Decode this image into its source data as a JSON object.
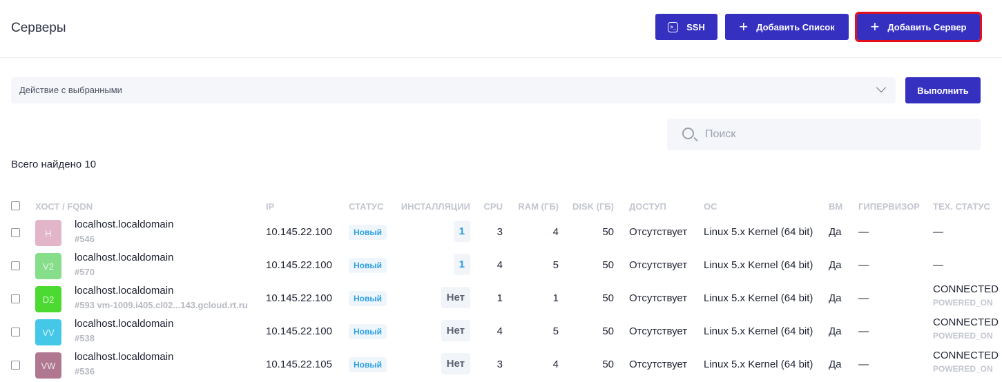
{
  "header": {
    "title": "Серверы",
    "ssh_label": "SSH",
    "add_list_label": "Добавить Список",
    "add_server_label": "Добавить Сервер"
  },
  "actions": {
    "select_placeholder": "Действие с выбранными",
    "run_label": "Выполнить"
  },
  "search": {
    "placeholder": "Поиск"
  },
  "total": "Всего найдено 10",
  "columns": {
    "host": "ХОСТ / FQDN",
    "ip": "IP",
    "status": "СТАТУС",
    "installs": "ИНСТАЛЛЯЦИИ",
    "cpu": "CPU",
    "ram": "RAM (ГБ)",
    "disk": "DISK (ГБ)",
    "access": "ДОСТУП",
    "os": "ОС",
    "vm": "ВМ",
    "hypervisor": "ГИПЕРВИЗОР",
    "tech_status": "ТЕХ. СТАТУС"
  },
  "rows": [
    {
      "avatar": "H",
      "avatar_color": "#e2b5c8",
      "name": "localhost.localdomain",
      "sub": "#546",
      "ip": "10.145.22.100",
      "status": "Новый",
      "installs": "1",
      "cpu": "3",
      "ram": "4",
      "disk": "50",
      "access": "Отсутствует",
      "os": "Linux 5.x Kernel (64 bit)",
      "vm": "Да",
      "hypervisor": "—",
      "tech": "—",
      "tech_sub": ""
    },
    {
      "avatar": "V2",
      "avatar_color": "#86dd8a",
      "name": "localhost.localdomain",
      "sub": "#570",
      "ip": "10.145.22.100",
      "status": "Новый",
      "installs": "1",
      "cpu": "4",
      "ram": "5",
      "disk": "50",
      "access": "Отсутствует",
      "os": "Linux 5.x Kernel (64 bit)",
      "vm": "Да",
      "hypervisor": "—",
      "tech": "—",
      "tech_sub": ""
    },
    {
      "avatar": "D2",
      "avatar_color": "#4cd932",
      "name": "localhost.localdomain",
      "sub": "#593 vm-1009.i405.cl02...143.gcloud.rt.ru",
      "ip": "10.145.22.100",
      "status": "Новый",
      "installs": "Нет",
      "cpu": "1",
      "ram": "1",
      "disk": "50",
      "access": "Отсутствует",
      "os": "Linux 5.x Kernel (64 bit)",
      "vm": "Да",
      "hypervisor": "—",
      "tech": "CONNECTED",
      "tech_sub": "POWERED_ON"
    },
    {
      "avatar": "VV",
      "avatar_color": "#45c8e8",
      "name": "localhost.localdomain",
      "sub": "#538",
      "ip": "10.145.22.100",
      "status": "Новый",
      "installs": "Нет",
      "cpu": "4",
      "ram": "5",
      "disk": "50",
      "access": "Отсутствует",
      "os": "Linux 5.x Kernel (64 bit)",
      "vm": "Да",
      "hypervisor": "—",
      "tech": "CONNECTED",
      "tech_sub": "POWERED_ON"
    },
    {
      "avatar": "VW",
      "avatar_color": "#b07890",
      "name": "localhost.localdomain",
      "sub": "#536",
      "ip": "10.145.22.105",
      "status": "Новый",
      "installs": "Нет",
      "cpu": "3",
      "ram": "4",
      "disk": "50",
      "access": "Отсутствует",
      "os": "Linux 5.x Kernel (64 bit)",
      "vm": "Да",
      "hypervisor": "—",
      "tech": "CONNECTED",
      "tech_sub": "POWERED_ON"
    }
  ]
}
